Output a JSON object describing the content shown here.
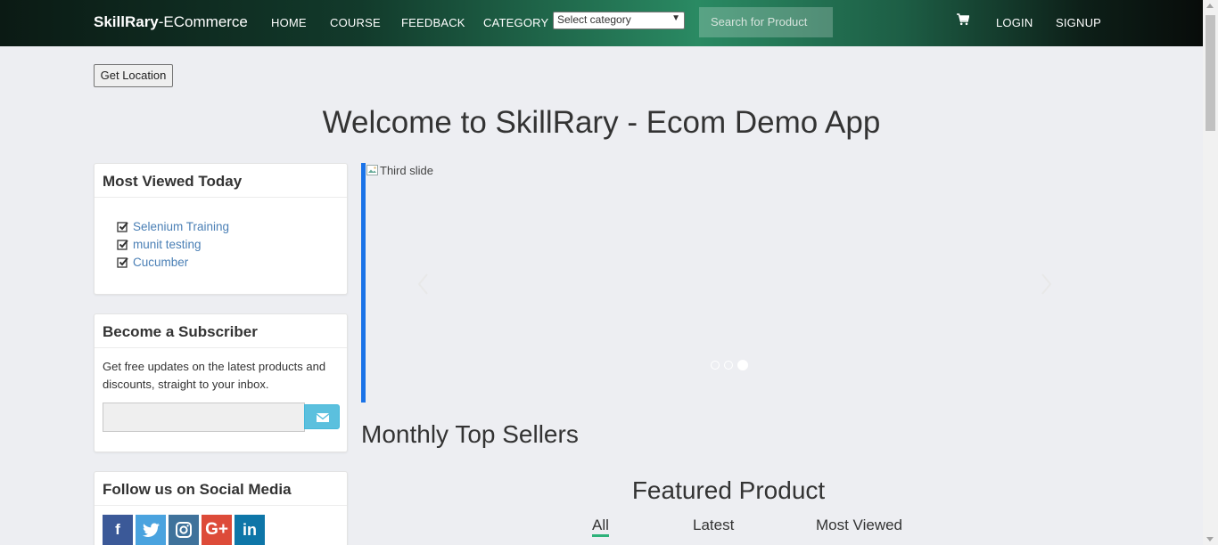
{
  "navbar": {
    "brand_bold": "SkillRary",
    "brand_rest": "-ECommerce",
    "links": [
      "HOME",
      "COURSE",
      "FEEDBACK",
      "CATEGORY"
    ],
    "category_select": "Select category",
    "search_placeholder": "Search for Product",
    "login": "LOGIN",
    "signup": "SIGNUP"
  },
  "get_location": "Get Location",
  "welcome_title": "Welcome to SkillRary - Ecom Demo App",
  "most_viewed": {
    "title": "Most Viewed Today",
    "items": [
      "Selenium Training",
      "munit testing",
      "Cucumber"
    ]
  },
  "subscriber": {
    "title": "Become a Subscriber",
    "text": "Get free updates on the latest products and discounts, straight to your inbox."
  },
  "social": {
    "title": "Follow us on Social Media",
    "networks": [
      "facebook-icon",
      "twitter-icon",
      "instagram-icon",
      "google-plus-icon",
      "linkedin-icon"
    ]
  },
  "carousel": {
    "image_alt": "Third slide",
    "active_slide": 3,
    "total_slides": 3
  },
  "monthly_top_sellers": "Monthly Top Sellers",
  "featured": {
    "title": "Featured Product",
    "tabs": [
      "All",
      "Latest",
      "Most Viewed"
    ],
    "active_tab": "All"
  },
  "colors": {
    "accent_blue": "#1a73e8",
    "link_blue": "#4a7fb5",
    "subscribe_button": "#5bc0de",
    "tab_underline": "#2db27a"
  }
}
